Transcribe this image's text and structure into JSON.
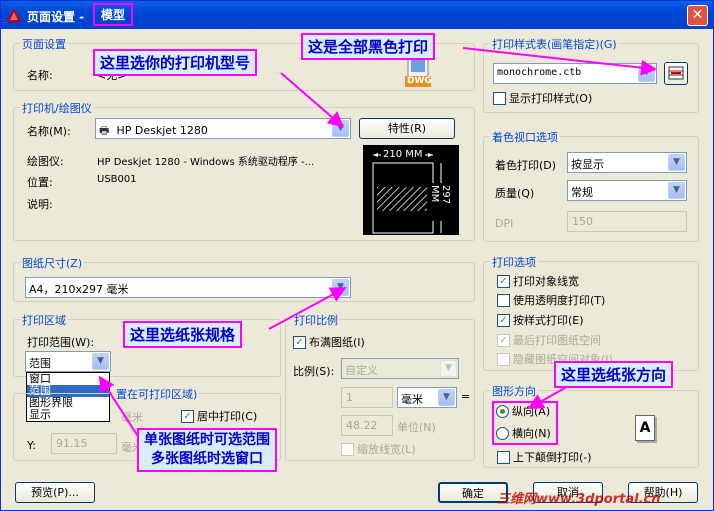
{
  "title": {
    "text": "页面设置 -",
    "model": "模型"
  },
  "page_setup": {
    "group": "页面设置",
    "name_label": "名称:",
    "name_value": "<无>"
  },
  "printer": {
    "group": "打印机/绘图仪",
    "name_label": "名称(M):",
    "name_value": "HP Deskjet 1280",
    "properties_btn": "特性(R)",
    "plotter_label": "绘图仪:",
    "plotter_value": "HP Deskjet 1280 - Windows 系统驱动程序 -...",
    "location_label": "位置:",
    "location_value": "USB001",
    "desc_label": "说明:",
    "preview_width": "210 MM",
    "preview_height": "297 MM"
  },
  "paper": {
    "group": "图纸尺寸(Z)",
    "value": "A4，210x297 毫米"
  },
  "plot_area": {
    "group": "打印区域",
    "range_label": "打印范围(W):",
    "range_value": "范围",
    "options": [
      "窗口",
      "范围",
      "图形界限",
      "显示"
    ],
    "selected_index": 1
  },
  "plot_offset": {
    "group_visible": "置在可打印区域)",
    "x_unit": "毫米",
    "center_label": "居中打印(C)",
    "y_label": "Y:",
    "y_value": "91.15",
    "y_unit": "毫米"
  },
  "plot_scale": {
    "group": "打印比例",
    "fit_label": "布满图纸(I)",
    "scale_label": "比例(S):",
    "scale_value": "自定义",
    "val1": "1",
    "unit_value": "毫米",
    "eq": "=",
    "val2": "48.22",
    "unit_label": "单位(N)",
    "lineweight_label": "缩放线宽(L)"
  },
  "plot_style": {
    "group": "打印样式表(画笔指定)(G)",
    "value": "monochrome.ctb",
    "show_label": "显示打印样式(O)"
  },
  "shaded": {
    "group": "着色视口选项",
    "shade_label": "着色打印(D)",
    "shade_value": "按显示",
    "quality_label": "质量(Q)",
    "quality_value": "常规",
    "dpi_label": "DPI",
    "dpi_value": "150"
  },
  "plot_options": {
    "group": "打印选项",
    "items": [
      {
        "label": "打印对象线宽",
        "checked": true,
        "disabled": false
      },
      {
        "label": "使用透明度打印(T)",
        "checked": false,
        "disabled": false
      },
      {
        "label": "按样式打印(E)",
        "checked": true,
        "disabled": false
      },
      {
        "label": "最后打印图纸空间",
        "checked": true,
        "disabled": true
      },
      {
        "label": "隐藏图纸空间对象(J)",
        "checked": false,
        "disabled": true
      }
    ]
  },
  "orientation": {
    "group": "图形方向",
    "portrait": "纵向(A)",
    "landscape": "横向(N)",
    "upside_down": "上下颠倒打印(-)",
    "icon_letter": "A"
  },
  "buttons": {
    "preview": "预览(P)...",
    "ok": "确定",
    "cancel": "取消",
    "help": "帮助(H)"
  },
  "annotations": {
    "printer_model": "这里选你的打印机型号",
    "all_black": "这是全部黑色打印",
    "paper_size": "这里选纸张规格",
    "paper_direction": "这里选纸张方向",
    "range_window": "单张图纸时可选范围\n多张图纸时选窗口"
  },
  "watermark": "三维网www.3dportal.cn",
  "dwg_icon": "DWG",
  "colors": {
    "annotation_border": "#ff00ff",
    "annotation_text": "#0000cc",
    "group_title": "#0046d5",
    "check_green": "#21a121"
  }
}
